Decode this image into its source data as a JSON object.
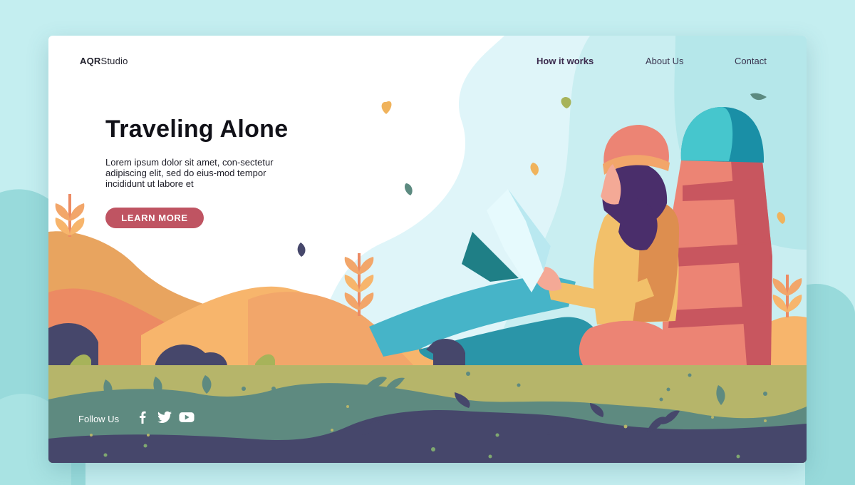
{
  "header": {
    "logo_bold": "AQR",
    "logo_light": "Studio",
    "nav": [
      {
        "label": "How it works",
        "active": true
      },
      {
        "label": "About Us",
        "active": false
      },
      {
        "label": "Contact",
        "active": false
      }
    ]
  },
  "hero": {
    "title": "Traveling Alone",
    "body": "Lorem ipsum dolor sit amet, con-sectetur adipiscing elit, sed do eius-mod tempor incididunt ut labore et",
    "cta_label": "LEARN MORE"
  },
  "footer": {
    "follow_label": "Follow Us",
    "social_icons": [
      "facebook-icon",
      "twitter-icon",
      "youtube-icon"
    ]
  },
  "illustration": {
    "subject": "traveler-with-backpack-reading-map"
  },
  "colors": {
    "accent": "#bf5462",
    "page_background": "#c4eef0",
    "sky": "#d9f4f7",
    "grass": "#b6b56a",
    "path": "#5e8a80",
    "ground_dark": "#46476b"
  }
}
